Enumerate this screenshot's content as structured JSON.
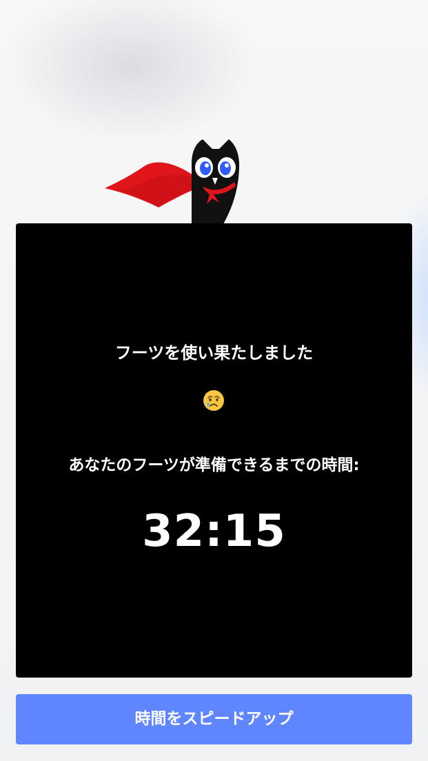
{
  "message": {
    "headline": "フーツを使い果たしました",
    "emoji": "crying-face-emoji",
    "subtext": "あなたのフーツが準備できるまでの時間:",
    "timer": "32:15"
  },
  "actions": {
    "speed_up_label": "時間をスピードアップ"
  },
  "colors": {
    "card_background": "#000000",
    "button_background": "#5f85ff",
    "cape_red": "#e0141b",
    "eye_blue": "#2f5cff"
  },
  "mascot": {
    "icon": "owl-with-red-cape-icon"
  }
}
